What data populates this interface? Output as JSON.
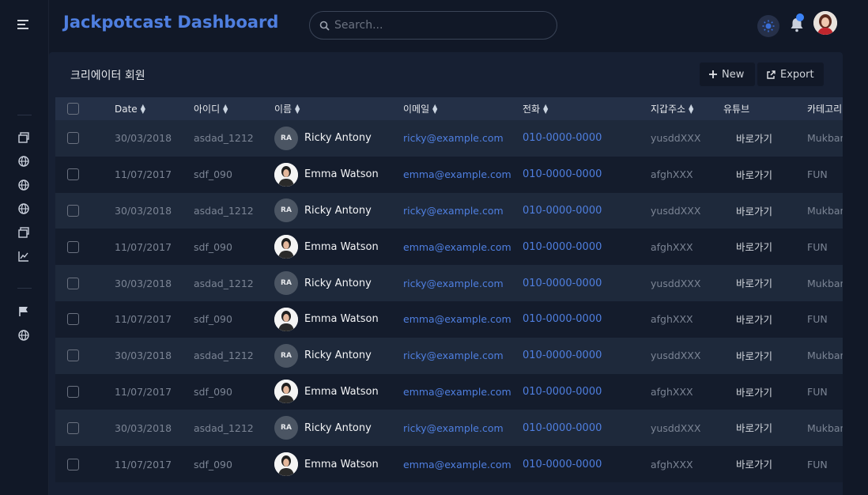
{
  "app": {
    "title": "Jackpotcast Dashboard"
  },
  "search": {
    "placeholder": "Search..."
  },
  "card": {
    "title": "크리에이터 회원",
    "new_label": "New",
    "export_label": "Export"
  },
  "table": {
    "columns": [
      "Date",
      "아이디",
      "이름",
      "이메일",
      "전화",
      "지갑주소",
      "유튜브",
      "카테고리"
    ],
    "rows": [
      {
        "date": "30/03/2018",
        "id": "asdad_1212",
        "name": "Ricky Antony",
        "initials": "RA",
        "email": "ricky@example.com",
        "phone": "010-0000-0000",
        "wallet": "yusddXXX",
        "youtube": "바로가기",
        "category": "Mukbang"
      },
      {
        "date": "11/07/2017",
        "id": "sdf_090",
        "name": "Emma Watson",
        "initials": "",
        "email": "emma@example.com",
        "phone": "010-0000-0000",
        "wallet": "afghXXX",
        "youtube": "바로가기",
        "category": "FUN"
      },
      {
        "date": "30/03/2018",
        "id": "asdad_1212",
        "name": "Ricky Antony",
        "initials": "RA",
        "email": "ricky@example.com",
        "phone": "010-0000-0000",
        "wallet": "yusddXXX",
        "youtube": "바로가기",
        "category": "Mukbang"
      },
      {
        "date": "11/07/2017",
        "id": "sdf_090",
        "name": "Emma Watson",
        "initials": "",
        "email": "emma@example.com",
        "phone": "010-0000-0000",
        "wallet": "afghXXX",
        "youtube": "바로가기",
        "category": "FUN"
      },
      {
        "date": "30/03/2018",
        "id": "asdad_1212",
        "name": "Ricky Antony",
        "initials": "RA",
        "email": "ricky@example.com",
        "phone": "010-0000-0000",
        "wallet": "yusddXXX",
        "youtube": "바로가기",
        "category": "Mukbang"
      },
      {
        "date": "11/07/2017",
        "id": "sdf_090",
        "name": "Emma Watson",
        "initials": "",
        "email": "emma@example.com",
        "phone": "010-0000-0000",
        "wallet": "afghXXX",
        "youtube": "바로가기",
        "category": "FUN"
      },
      {
        "date": "30/03/2018",
        "id": "asdad_1212",
        "name": "Ricky Antony",
        "initials": "RA",
        "email": "ricky@example.com",
        "phone": "010-0000-0000",
        "wallet": "yusddXXX",
        "youtube": "바로가기",
        "category": "Mukbang"
      },
      {
        "date": "11/07/2017",
        "id": "sdf_090",
        "name": "Emma Watson",
        "initials": "",
        "email": "emma@example.com",
        "phone": "010-0000-0000",
        "wallet": "afghXXX",
        "youtube": "바로가기",
        "category": "FUN"
      },
      {
        "date": "30/03/2018",
        "id": "asdad_1212",
        "name": "Ricky Antony",
        "initials": "RA",
        "email": "ricky@example.com",
        "phone": "010-0000-0000",
        "wallet": "yusddXXX",
        "youtube": "바로가기",
        "category": "Mukbang"
      },
      {
        "date": "11/07/2017",
        "id": "sdf_090",
        "name": "Emma Watson",
        "initials": "",
        "email": "emma@example.com",
        "phone": "010-0000-0000",
        "wallet": "afghXXX",
        "youtube": "바로가기",
        "category": "FUN"
      }
    ]
  },
  "sidebar": {
    "icons": [
      "menu-icon",
      "windows-icon",
      "globe-icon",
      "globe-icon",
      "globe-icon",
      "windows-icon",
      "chart-icon",
      "flag-icon",
      "globe-icon"
    ]
  },
  "colors": {
    "accent": "#4f7fe0",
    "notification_dot": "#3b82f6"
  }
}
